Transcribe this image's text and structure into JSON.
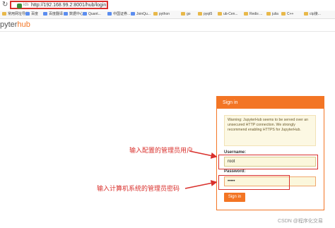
{
  "browser": {
    "reload_icon": "reload-icon",
    "url_host": "http://192.168.99.2",
    "url_path": ":8001/hub/login",
    "site_tag": "ids",
    "bookmarks": [
      {
        "label": "常用网址导航",
        "icon": "folder"
      },
      {
        "label": "百度",
        "icon": "site"
      },
      {
        "label": "百度翻译",
        "icon": "site"
      },
      {
        "label": "数据中心",
        "icon": "site"
      },
      {
        "label": "Quant...",
        "icon": "site"
      },
      {
        "label": "中国证券...",
        "icon": "site"
      },
      {
        "label": "JoinQu...",
        "icon": "site"
      },
      {
        "label": "python",
        "icon": "folder"
      },
      {
        "label": "go",
        "icon": "folder"
      },
      {
        "label": "pyqt5",
        "icon": "folder"
      },
      {
        "label": "ub-Cen...",
        "icon": "folder"
      },
      {
        "label": "Redis ...",
        "icon": "folder"
      },
      {
        "label": "julia",
        "icon": "folder"
      },
      {
        "label": "C++",
        "icon": "folder"
      },
      {
        "label": "ctp接...",
        "icon": "folder"
      }
    ]
  },
  "brand": {
    "prefix": "pyter",
    "accent": "hub",
    "accent_color": "#f37524"
  },
  "login": {
    "title": "Sign in",
    "warning": "Warning: JupyterHub seems to be served over an unsecured HTTP connection. We strongly recommend enabling HTTPS for JupyterHub.",
    "username_label": "Username:",
    "username_value": "root",
    "password_label": "Password:",
    "password_value": "•••••",
    "submit_label": "Sign in"
  },
  "annotations": {
    "username_note": "输入配置的管理员用户",
    "password_note": "输入计算机系统的管理员密码",
    "color": "#d9302c"
  },
  "watermark": "CSDN @程序化交易"
}
